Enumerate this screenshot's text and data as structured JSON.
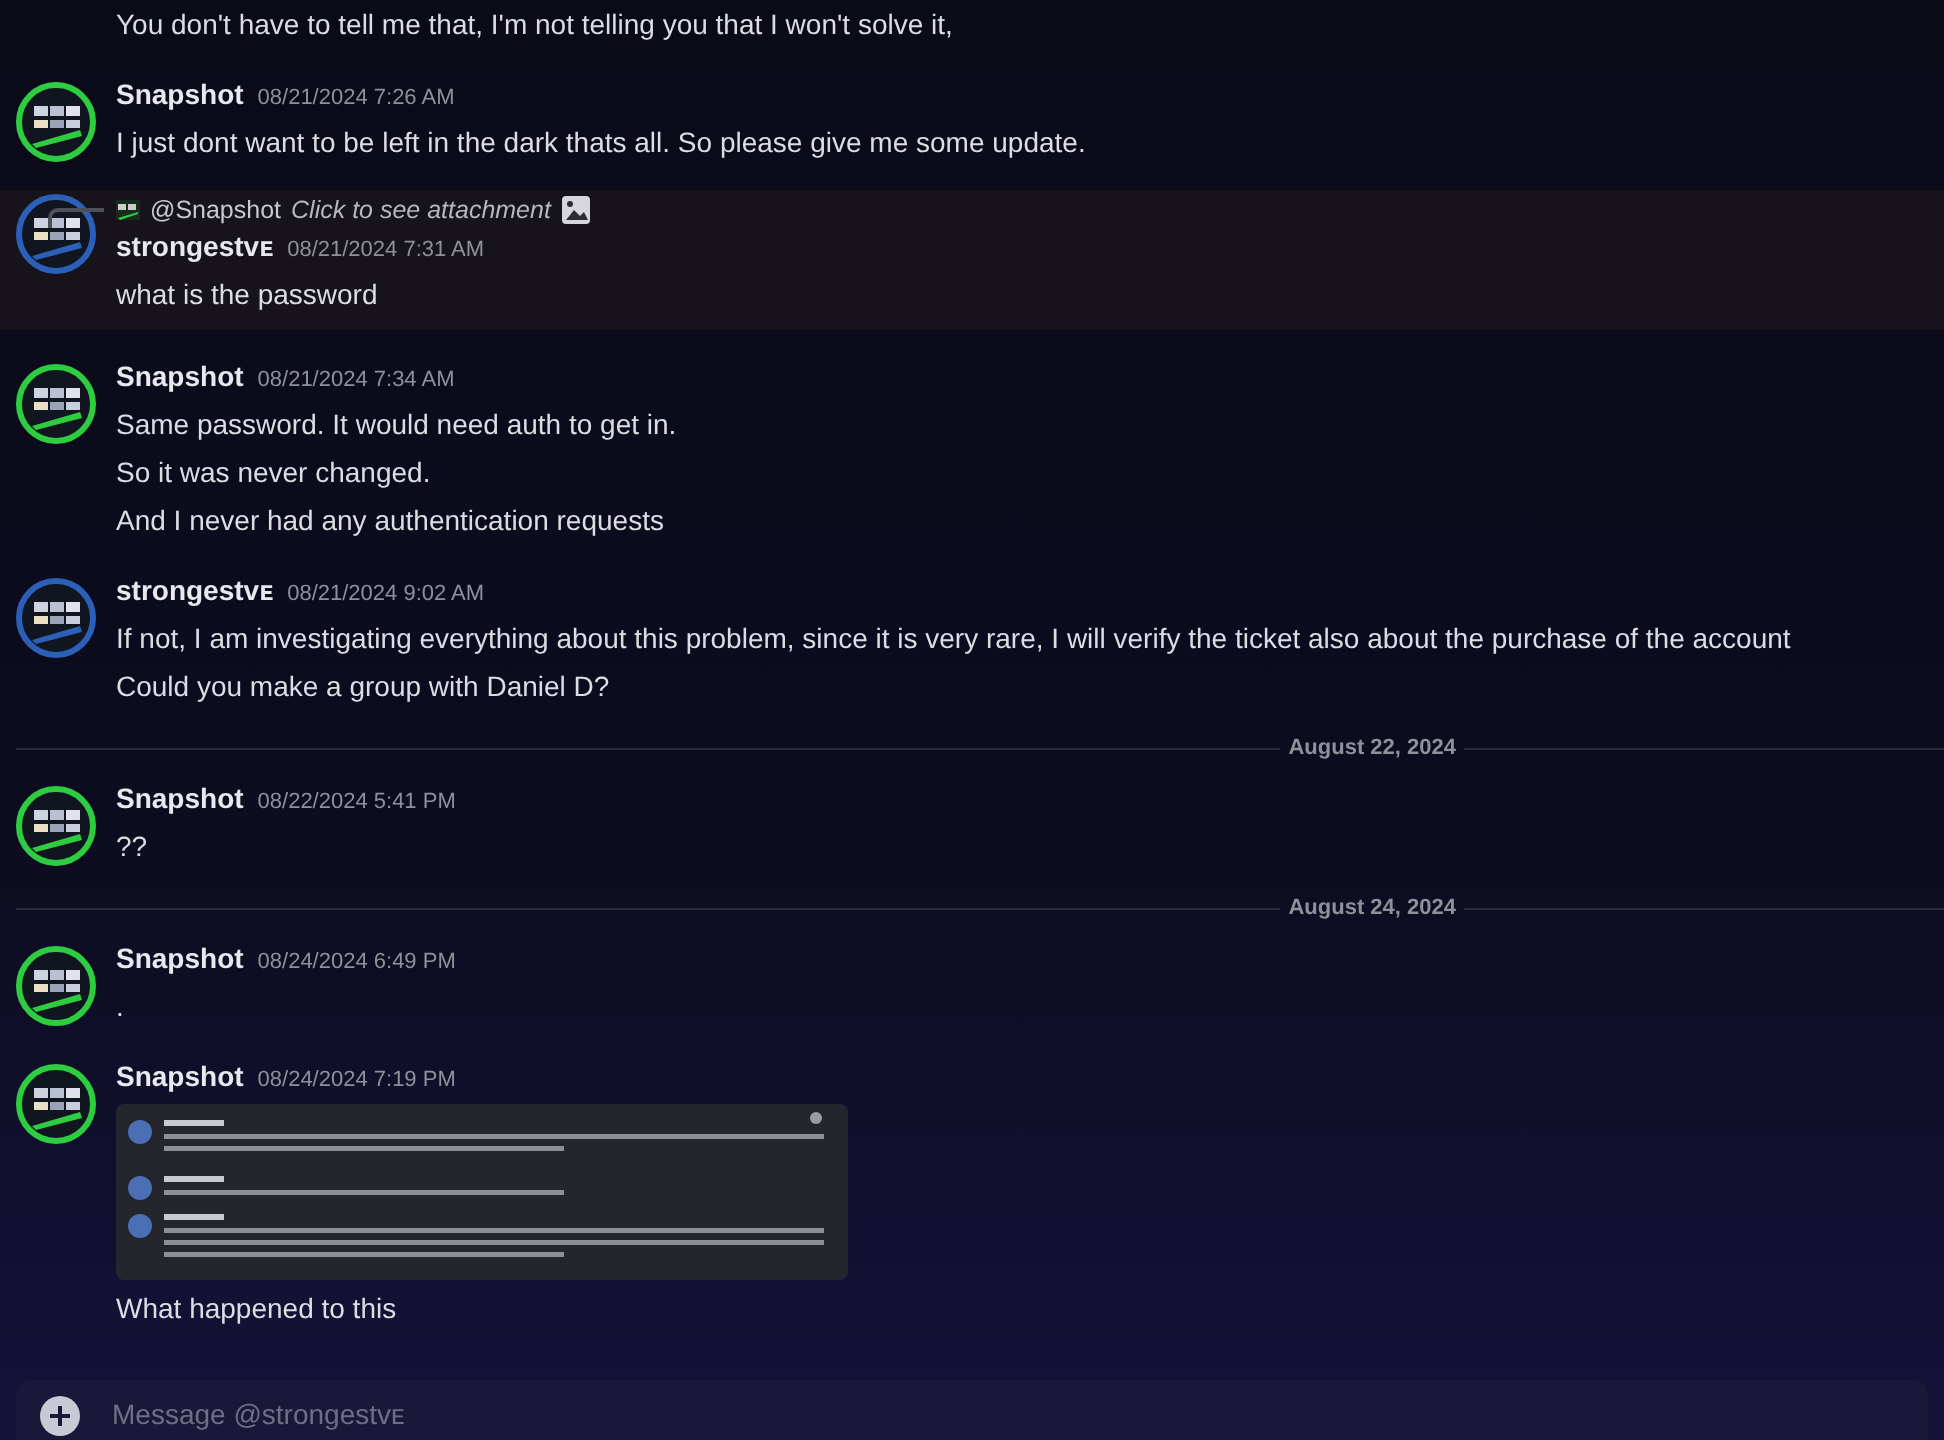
{
  "messages": [
    {
      "kind": "continuation",
      "lines": [
        "You don't have to tell me that, I'm not telling you that I won't solve it,"
      ]
    },
    {
      "kind": "message",
      "color": "#2ecc40",
      "author": "Snapshot",
      "time": "08/21/2024 7:26 AM",
      "highlighted": false,
      "lines": [
        "I just dont want to be left in the dark thats all. So please give me some update."
      ]
    },
    {
      "kind": "message",
      "color": "#2c5fb8",
      "author": "strongestvᴇ",
      "time": "08/21/2024 7:31 AM",
      "highlighted": true,
      "reply": {
        "author": "@Snapshot",
        "text": "Click to see attachment"
      },
      "lines": [
        "what is the password"
      ]
    },
    {
      "kind": "message",
      "color": "#2ecc40",
      "author": "Snapshot",
      "time": "08/21/2024 7:34 AM",
      "highlighted": false,
      "lines": [
        "Same password. It would need auth to get in.",
        "So it was never changed.",
        "And I never had any authentication requests"
      ]
    },
    {
      "kind": "message",
      "color": "#2c5fb8",
      "author": "strongestvᴇ",
      "time": "08/21/2024 9:02 AM",
      "highlighted": false,
      "lines": [
        "If not, I am investigating everything about this problem, since it is very rare, I will verify the ticket also about the purchase of the account",
        "Could you make a group with Daniel D?"
      ]
    },
    {
      "kind": "divider",
      "label": "August 22, 2024"
    },
    {
      "kind": "message",
      "color": "#2ecc40",
      "author": "Snapshot",
      "time": "08/22/2024 5:41 PM",
      "highlighted": false,
      "lines": [
        "??"
      ]
    },
    {
      "kind": "divider",
      "label": "August 24, 2024"
    },
    {
      "kind": "message",
      "color": "#2ecc40",
      "author": "Snapshot",
      "time": "08/24/2024 6:49 PM",
      "highlighted": false,
      "lines": [
        "."
      ]
    },
    {
      "kind": "message",
      "color": "#2ecc40",
      "author": "Snapshot",
      "time": "08/24/2024 7:19 PM",
      "highlighted": false,
      "attachment": true,
      "lines": [
        "What happened to this"
      ]
    }
  ],
  "composer": {
    "placeholder": "Message @strongestvᴇ"
  }
}
